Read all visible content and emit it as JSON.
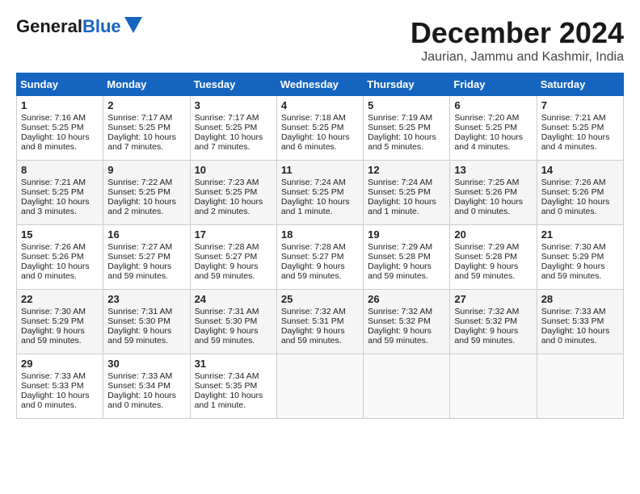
{
  "header": {
    "logo_general": "General",
    "logo_blue": "Blue",
    "month_title": "December 2024",
    "location": "Jaurian, Jammu and Kashmir, India"
  },
  "weekdays": [
    "Sunday",
    "Monday",
    "Tuesday",
    "Wednesday",
    "Thursday",
    "Friday",
    "Saturday"
  ],
  "weeks": [
    [
      {
        "day": "1",
        "sunrise": "Sunrise: 7:16 AM",
        "sunset": "Sunset: 5:25 PM",
        "daylight": "Daylight: 10 hours and 8 minutes."
      },
      {
        "day": "2",
        "sunrise": "Sunrise: 7:17 AM",
        "sunset": "Sunset: 5:25 PM",
        "daylight": "Daylight: 10 hours and 7 minutes."
      },
      {
        "day": "3",
        "sunrise": "Sunrise: 7:17 AM",
        "sunset": "Sunset: 5:25 PM",
        "daylight": "Daylight: 10 hours and 7 minutes."
      },
      {
        "day": "4",
        "sunrise": "Sunrise: 7:18 AM",
        "sunset": "Sunset: 5:25 PM",
        "daylight": "Daylight: 10 hours and 6 minutes."
      },
      {
        "day": "5",
        "sunrise": "Sunrise: 7:19 AM",
        "sunset": "Sunset: 5:25 PM",
        "daylight": "Daylight: 10 hours and 5 minutes."
      },
      {
        "day": "6",
        "sunrise": "Sunrise: 7:20 AM",
        "sunset": "Sunset: 5:25 PM",
        "daylight": "Daylight: 10 hours and 4 minutes."
      },
      {
        "day": "7",
        "sunrise": "Sunrise: 7:21 AM",
        "sunset": "Sunset: 5:25 PM",
        "daylight": "Daylight: 10 hours and 4 minutes."
      }
    ],
    [
      {
        "day": "8",
        "sunrise": "Sunrise: 7:21 AM",
        "sunset": "Sunset: 5:25 PM",
        "daylight": "Daylight: 10 hours and 3 minutes."
      },
      {
        "day": "9",
        "sunrise": "Sunrise: 7:22 AM",
        "sunset": "Sunset: 5:25 PM",
        "daylight": "Daylight: 10 hours and 2 minutes."
      },
      {
        "day": "10",
        "sunrise": "Sunrise: 7:23 AM",
        "sunset": "Sunset: 5:25 PM",
        "daylight": "Daylight: 10 hours and 2 minutes."
      },
      {
        "day": "11",
        "sunrise": "Sunrise: 7:24 AM",
        "sunset": "Sunset: 5:25 PM",
        "daylight": "Daylight: 10 hours and 1 minute."
      },
      {
        "day": "12",
        "sunrise": "Sunrise: 7:24 AM",
        "sunset": "Sunset: 5:25 PM",
        "daylight": "Daylight: 10 hours and 1 minute."
      },
      {
        "day": "13",
        "sunrise": "Sunrise: 7:25 AM",
        "sunset": "Sunset: 5:26 PM",
        "daylight": "Daylight: 10 hours and 0 minutes."
      },
      {
        "day": "14",
        "sunrise": "Sunrise: 7:26 AM",
        "sunset": "Sunset: 5:26 PM",
        "daylight": "Daylight: 10 hours and 0 minutes."
      }
    ],
    [
      {
        "day": "15",
        "sunrise": "Sunrise: 7:26 AM",
        "sunset": "Sunset: 5:26 PM",
        "daylight": "Daylight: 10 hours and 0 minutes."
      },
      {
        "day": "16",
        "sunrise": "Sunrise: 7:27 AM",
        "sunset": "Sunset: 5:27 PM",
        "daylight": "Daylight: 9 hours and 59 minutes."
      },
      {
        "day": "17",
        "sunrise": "Sunrise: 7:28 AM",
        "sunset": "Sunset: 5:27 PM",
        "daylight": "Daylight: 9 hours and 59 minutes."
      },
      {
        "day": "18",
        "sunrise": "Sunrise: 7:28 AM",
        "sunset": "Sunset: 5:27 PM",
        "daylight": "Daylight: 9 hours and 59 minutes."
      },
      {
        "day": "19",
        "sunrise": "Sunrise: 7:29 AM",
        "sunset": "Sunset: 5:28 PM",
        "daylight": "Daylight: 9 hours and 59 minutes."
      },
      {
        "day": "20",
        "sunrise": "Sunrise: 7:29 AM",
        "sunset": "Sunset: 5:28 PM",
        "daylight": "Daylight: 9 hours and 59 minutes."
      },
      {
        "day": "21",
        "sunrise": "Sunrise: 7:30 AM",
        "sunset": "Sunset: 5:29 PM",
        "daylight": "Daylight: 9 hours and 59 minutes."
      }
    ],
    [
      {
        "day": "22",
        "sunrise": "Sunrise: 7:30 AM",
        "sunset": "Sunset: 5:29 PM",
        "daylight": "Daylight: 9 hours and 59 minutes."
      },
      {
        "day": "23",
        "sunrise": "Sunrise: 7:31 AM",
        "sunset": "Sunset: 5:30 PM",
        "daylight": "Daylight: 9 hours and 59 minutes."
      },
      {
        "day": "24",
        "sunrise": "Sunrise: 7:31 AM",
        "sunset": "Sunset: 5:30 PM",
        "daylight": "Daylight: 9 hours and 59 minutes."
      },
      {
        "day": "25",
        "sunrise": "Sunrise: 7:32 AM",
        "sunset": "Sunset: 5:31 PM",
        "daylight": "Daylight: 9 hours and 59 minutes."
      },
      {
        "day": "26",
        "sunrise": "Sunrise: 7:32 AM",
        "sunset": "Sunset: 5:32 PM",
        "daylight": "Daylight: 9 hours and 59 minutes."
      },
      {
        "day": "27",
        "sunrise": "Sunrise: 7:32 AM",
        "sunset": "Sunset: 5:32 PM",
        "daylight": "Daylight: 9 hours and 59 minutes."
      },
      {
        "day": "28",
        "sunrise": "Sunrise: 7:33 AM",
        "sunset": "Sunset: 5:33 PM",
        "daylight": "Daylight: 10 hours and 0 minutes."
      }
    ],
    [
      {
        "day": "29",
        "sunrise": "Sunrise: 7:33 AM",
        "sunset": "Sunset: 5:33 PM",
        "daylight": "Daylight: 10 hours and 0 minutes."
      },
      {
        "day": "30",
        "sunrise": "Sunrise: 7:33 AM",
        "sunset": "Sunset: 5:34 PM",
        "daylight": "Daylight: 10 hours and 0 minutes."
      },
      {
        "day": "31",
        "sunrise": "Sunrise: 7:34 AM",
        "sunset": "Sunset: 5:35 PM",
        "daylight": "Daylight: 10 hours and 1 minute."
      },
      null,
      null,
      null,
      null
    ]
  ]
}
